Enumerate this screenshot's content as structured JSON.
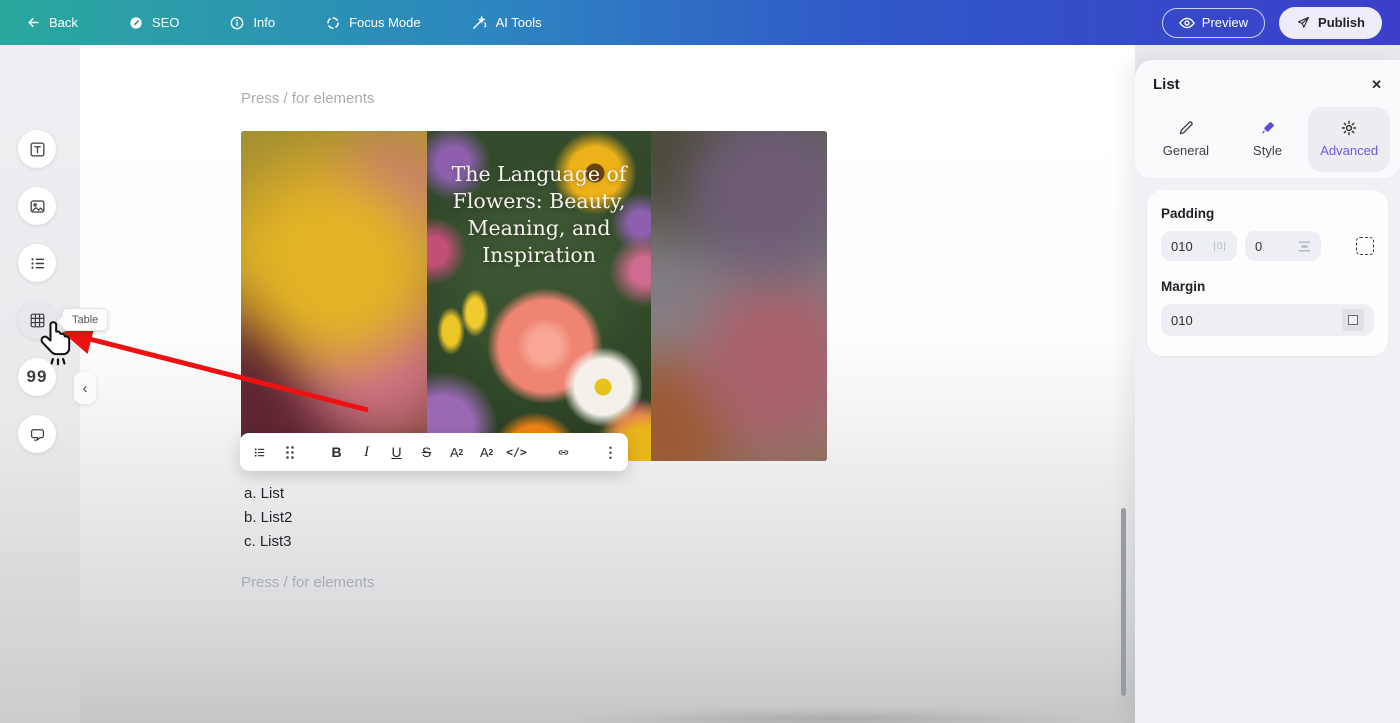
{
  "topbar": {
    "back_label": "Back",
    "seo_label": "SEO",
    "info_label": "Info",
    "focus_label": "Focus Mode",
    "ai_label": "AI Tools",
    "preview_label": "Preview",
    "publish_label": "Publish",
    "gradient_left_color": "#2aa89e",
    "gradient_right_color": "#3b3fca"
  },
  "sidebar": {
    "tooltip": "Table",
    "quote_glyph": "99",
    "collapse_glyph": "‹",
    "items": [
      {
        "name": "text-element"
      },
      {
        "name": "image-element"
      },
      {
        "name": "list-element"
      },
      {
        "name": "table-element"
      },
      {
        "name": "quote-element"
      },
      {
        "name": "comment-element"
      }
    ]
  },
  "canvas": {
    "placeholder": "Press / for elements",
    "image_title_lines": [
      "The Language of",
      "Flowers: Beauty,",
      "Meaning, and",
      "Inspiration"
    ],
    "list_items": [
      "a. List",
      "b. List2",
      "c. List3"
    ],
    "toolbar": {
      "bold": "B",
      "italic": "I",
      "underline": "U",
      "strike": "S",
      "sup_base": "A",
      "sup_mark": "2",
      "sub_base": "A",
      "sub_mark": "2",
      "code": "</>",
      "kebab": "⋮"
    }
  },
  "panel": {
    "title": "List",
    "close_glyph": "✕",
    "tabs": [
      {
        "label": "General"
      },
      {
        "label": "Style"
      },
      {
        "label": "Advanced",
        "active": true
      }
    ],
    "padding": {
      "label": "Padding",
      "value_h": "010",
      "icon_h": "|0|",
      "value_v": "0"
    },
    "margin": {
      "label": "Margin",
      "value": "010"
    },
    "accent_color": "#6a5be2"
  },
  "annotation": {
    "arrow_color": "#ee1111"
  }
}
